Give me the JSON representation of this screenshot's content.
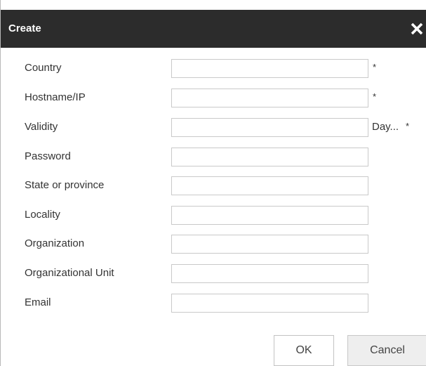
{
  "dialog": {
    "title": "Create",
    "close_icon": "close-icon"
  },
  "form": {
    "fields": [
      {
        "label": "Country",
        "value": "",
        "required_mark": "*"
      },
      {
        "label": "Hostname/IP",
        "value": "",
        "required_mark": "*"
      },
      {
        "label": "Validity",
        "value": "",
        "unit": "Day...",
        "required_mark": "*"
      },
      {
        "label": "Password",
        "value": ""
      },
      {
        "label": "State or province",
        "value": ""
      },
      {
        "label": "Locality",
        "value": ""
      },
      {
        "label": "Organization",
        "value": ""
      },
      {
        "label": "Organizational Unit",
        "value": ""
      },
      {
        "label": "Email",
        "value": ""
      }
    ]
  },
  "buttons": {
    "ok_label": "OK",
    "cancel_label": "Cancel"
  },
  "colors": {
    "titlebar_bg": "#2c2c2c",
    "title_text": "#ffffff",
    "input_border": "#c9c9c9",
    "cancel_bg": "#eeeeee"
  }
}
